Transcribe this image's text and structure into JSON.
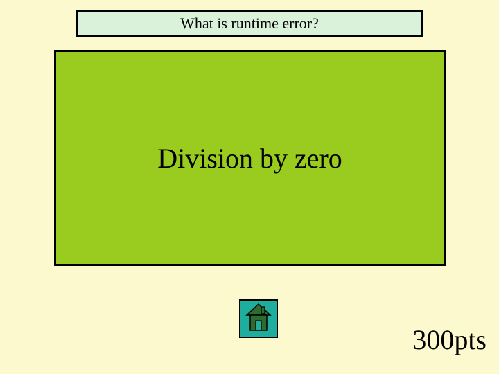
{
  "question": "What is runtime error?",
  "answer": "Division by zero",
  "points": "300pts",
  "icons": {
    "home": "home-icon"
  },
  "colors": {
    "background": "#fdf9ce",
    "questionBox": "#d9f2d9",
    "answerBox": "#99cc1f",
    "homeButton": "#1fae9e",
    "border": "#000000"
  }
}
